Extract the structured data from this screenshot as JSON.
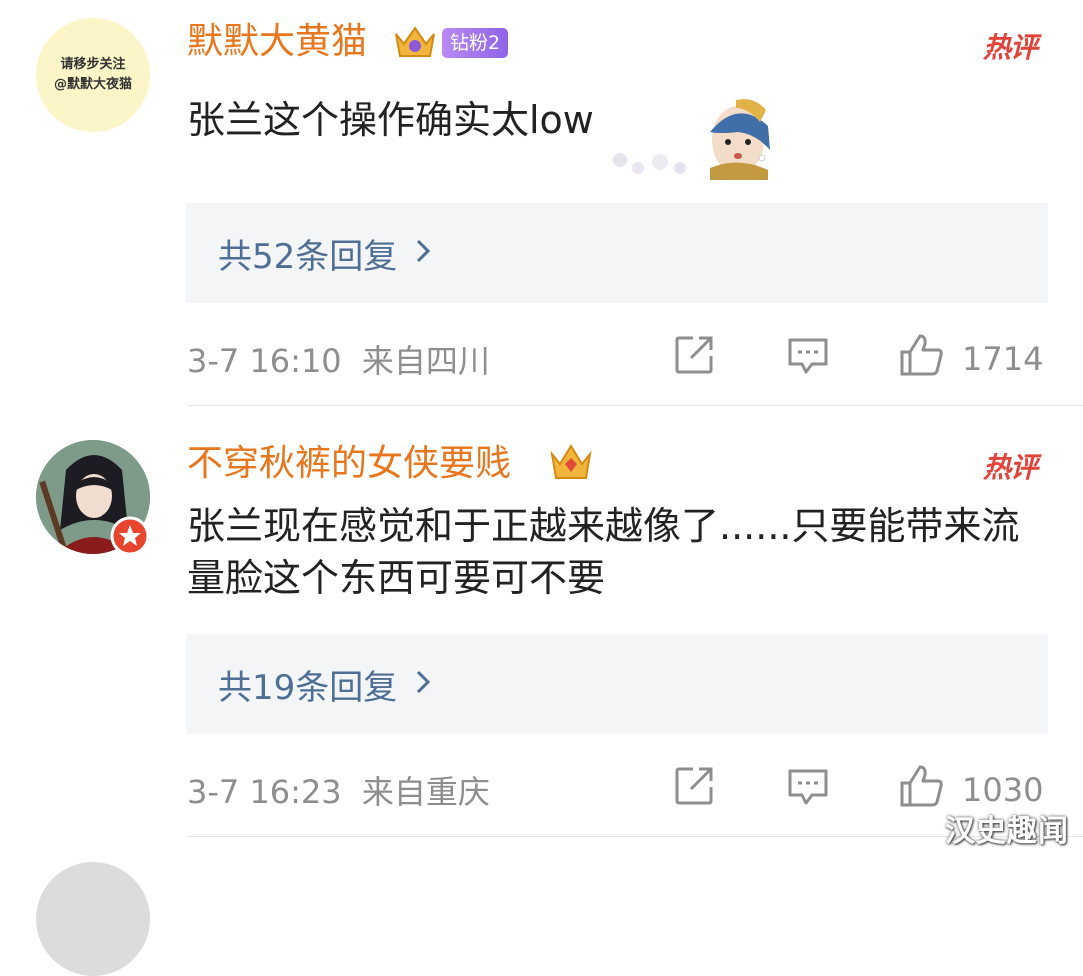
{
  "comments": [
    {
      "avatar_text_line1": "请移步关注",
      "avatar_text_line2": "@默默大夜猫",
      "username": "默默大黄猫",
      "fan_badge": "钻粉2",
      "hot_label": "热评",
      "text": "张兰这个操作确实太low",
      "replies_label": "共52条回复",
      "time": "3-7 16:10",
      "location": "来自四川",
      "likes": "1714"
    },
    {
      "username": "不穿秋裤的女侠要贱",
      "hot_label": "热评",
      "text": "张兰现在感觉和于正越来越像了......只要能带来流量脸这个东西可要可不要",
      "replies_label": "共19条回复",
      "time": "3-7 16:23",
      "location": "来自重庆",
      "likes": "1030"
    }
  ],
  "watermark": "汉史趣闻",
  "colors": {
    "username": "#e8761c",
    "reply_link": "#4f6e96",
    "hot": "#e2443c",
    "meta": "#8e8e8e"
  }
}
